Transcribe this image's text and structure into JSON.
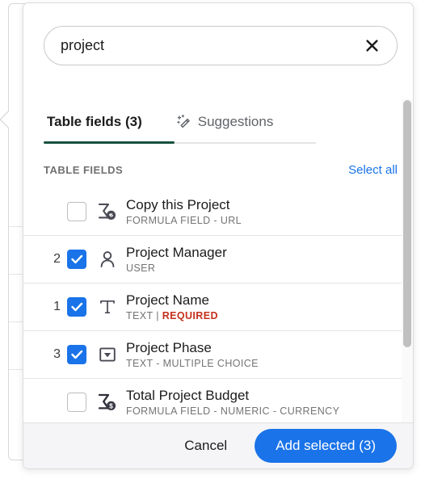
{
  "search": {
    "value": "project",
    "placeholder": "Search fields",
    "clear_icon": "close-icon"
  },
  "tabs": [
    {
      "label": "Table fields (3)",
      "active": true,
      "icon": null
    },
    {
      "label": "Suggestions",
      "active": false,
      "icon": "magic-wand-icon"
    }
  ],
  "section": {
    "title": "TABLE FIELDS",
    "select_all_label": "Select all"
  },
  "fields": [
    {
      "order": "",
      "checked": false,
      "icon": "formula-url-icon",
      "title": "Copy this Project",
      "subtitle": "FORMULA FIELD - URL",
      "required": false
    },
    {
      "order": "2",
      "checked": true,
      "icon": "user-icon",
      "title": "Project Manager",
      "subtitle": "USER",
      "required": false
    },
    {
      "order": "1",
      "checked": true,
      "icon": "text-icon",
      "title": "Project Name",
      "subtitle": "TEXT | ",
      "required": true,
      "required_label": "REQUIRED"
    },
    {
      "order": "3",
      "checked": true,
      "icon": "dropdown-icon",
      "title": "Project Phase",
      "subtitle": "TEXT - MULTIPLE CHOICE",
      "required": false
    },
    {
      "order": "",
      "checked": false,
      "icon": "formula-currency-icon",
      "title": "Total Project Budget",
      "subtitle": "FORMULA FIELD - NUMERIC - CURRENCY",
      "required": false
    }
  ],
  "footer": {
    "cancel_label": "Cancel",
    "add_label": "Add selected (3)"
  },
  "colors": {
    "accent_blue": "#1a73e8",
    "tab_underline": "#17513f",
    "required_red": "#c5321b",
    "footer_bg": "#f5f5f7"
  }
}
